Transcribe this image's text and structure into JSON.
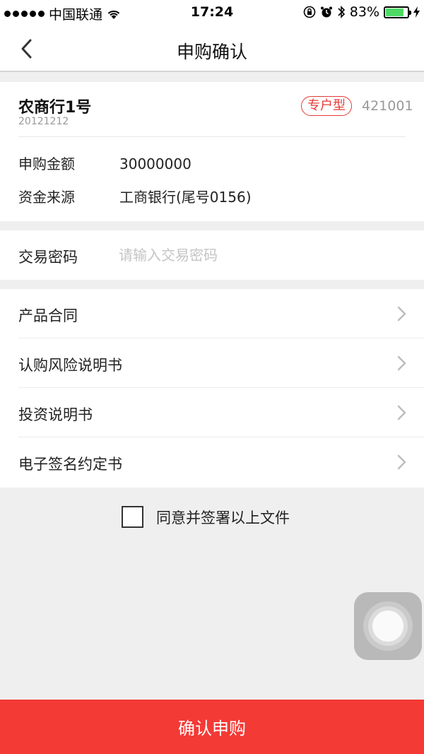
{
  "status_bar": {
    "carrier": "中国联通",
    "time": "17:24",
    "battery": "83%",
    "battery_level": 0.83
  },
  "nav": {
    "title": "申购确认"
  },
  "product": {
    "name": "农商行1号",
    "code": "20121212",
    "tag": "专户型",
    "id": "421001",
    "amount_label": "申购金额",
    "amount_value": "30000000",
    "source_label": "资金来源",
    "source_value": "工商银行(尾号0156)"
  },
  "password": {
    "label": "交易密码",
    "placeholder": "请输入交易密码",
    "value": ""
  },
  "documents": [
    {
      "label": "产品合同"
    },
    {
      "label": "认购风险说明书"
    },
    {
      "label": "投资说明书"
    },
    {
      "label": "电子签名约定书"
    }
  ],
  "agreement": {
    "text": "同意并签署以上文件",
    "checked": false
  },
  "confirm_button": {
    "label": "确认申购"
  },
  "colors": {
    "accent": "#f43a35",
    "tag_red": "#e53935",
    "battery_green": "#4cd964",
    "background": "#efefef"
  }
}
